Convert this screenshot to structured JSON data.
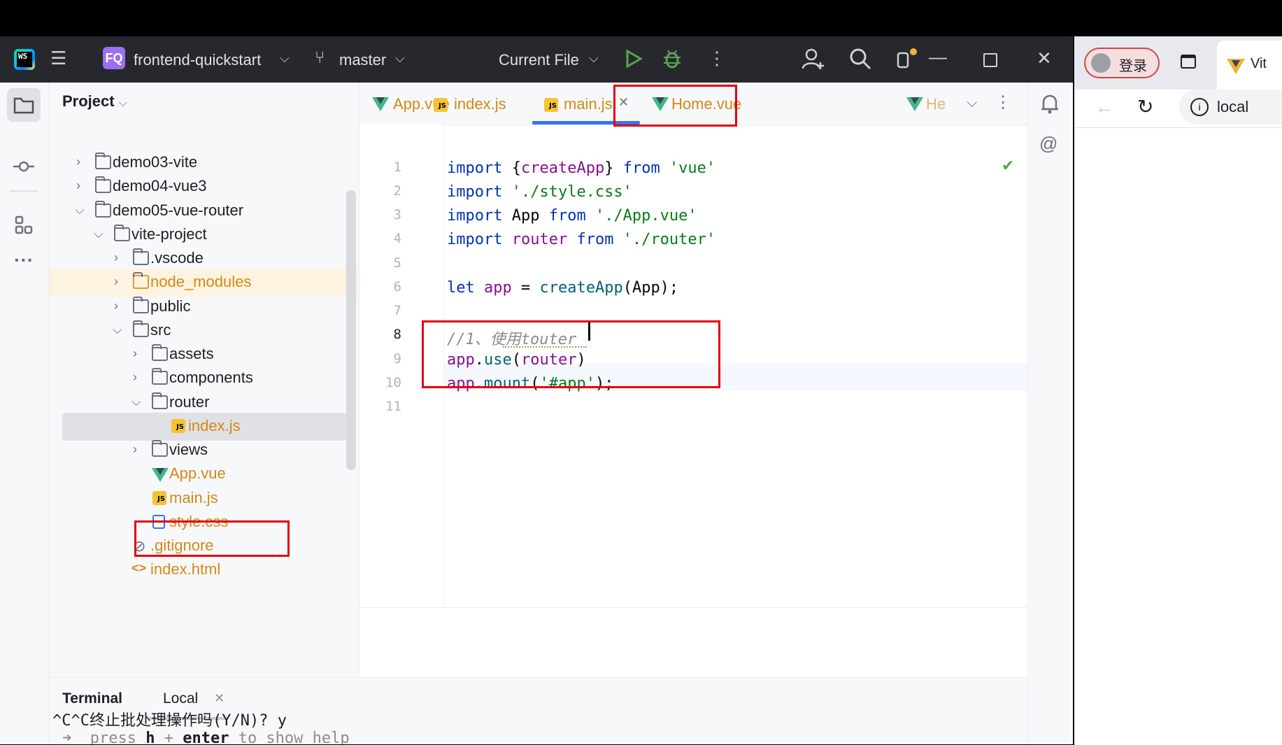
{
  "ide": {
    "project_badge": "FQ",
    "project_name": "frontend-quickstart",
    "branch": "master",
    "run_config": "Current File",
    "project_panel_title": "Project",
    "tree": [
      {
        "label": "demo03-vite",
        "kind": "folder",
        "expanded": false
      },
      {
        "label": "demo04-vue3",
        "kind": "folder",
        "expanded": false
      },
      {
        "label": "demo05-vue-router",
        "kind": "folder",
        "expanded": true
      },
      {
        "label": "vite-project",
        "kind": "folder",
        "expanded": true
      },
      {
        "label": ".vscode",
        "kind": "folder",
        "expanded": false
      },
      {
        "label": "node_modules",
        "kind": "folder",
        "expanded": false
      },
      {
        "label": "public",
        "kind": "folder",
        "expanded": false
      },
      {
        "label": "src",
        "kind": "folder",
        "expanded": true
      },
      {
        "label": "assets",
        "kind": "folder",
        "expanded": false
      },
      {
        "label": "components",
        "kind": "folder",
        "expanded": false
      },
      {
        "label": "router",
        "kind": "folder",
        "expanded": true
      },
      {
        "label": "index.js",
        "kind": "js"
      },
      {
        "label": "views",
        "kind": "folder",
        "expanded": false
      },
      {
        "label": "App.vue",
        "kind": "vue"
      },
      {
        "label": "main.js",
        "kind": "js"
      },
      {
        "label": "style.css",
        "kind": "css"
      },
      {
        "label": ".gitignore",
        "kind": "ignore"
      },
      {
        "label": "index.html",
        "kind": "html"
      }
    ],
    "tabs": [
      {
        "label": "App.vue",
        "kind": "vue"
      },
      {
        "label": "index.js",
        "kind": "js"
      },
      {
        "label": "main.js",
        "kind": "js",
        "active": true
      },
      {
        "label": "Home.vue",
        "kind": "vue"
      },
      {
        "label": "He",
        "kind": "vue"
      }
    ],
    "line_numbers": [
      "1",
      "2",
      "3",
      "4",
      "5",
      "6",
      "7",
      "8",
      "9",
      "10",
      "11"
    ],
    "code": {
      "l1_kw": "import",
      "l1_a": " {",
      "l1_fn": "createApp",
      "l1_b": "} ",
      "l1_kw2": "from",
      "l1_str": " 'vue'",
      "l2_kw": "import",
      "l2_str": " './style.css'",
      "l3_kw": "import",
      "l3_a": " App ",
      "l3_kw2": "from",
      "l3_str": " './App.vue'",
      "l4_kw": "import",
      "l4_var": " router ",
      "l4_kw2": "from",
      "l4_str": " './router'",
      "l6_kw": "let",
      "l6_var": " app",
      "l6_a": " = ",
      "l6_fn": "createApp",
      "l6_b": "(App);",
      "l8_cm": "//1、使用touter",
      "l9_var": "app",
      "l9_a": ".",
      "l9_fn": "use",
      "l9_b": "(",
      "l9_var2": "router",
      "l9_c": ")",
      "l10_var": "app",
      "l10_a": ".",
      "l10_fn": "mount",
      "l10_b": "(",
      "l10_str": "'#app'",
      "l10_c": ");"
    },
    "terminal": {
      "title": "Terminal",
      "tab": "Local",
      "line1_arrow": "➜",
      "line1_a": "  press ",
      "line1_h": "h",
      "line1_b": " + ",
      "line1_enter": "enter",
      "line1_c": " to show help",
      "line2": "^C^C终止批处理操作吗(Y/N)? y"
    }
  },
  "browser": {
    "login_label": "登录",
    "tab_label": "Vit",
    "address": "local"
  },
  "colors": {
    "title_bar": "#27282e",
    "highlight_box": "#e3000f",
    "active_tab_underline": "#3574f0",
    "vue_green": "#41b883",
    "js_yellow": "#f4c430"
  }
}
